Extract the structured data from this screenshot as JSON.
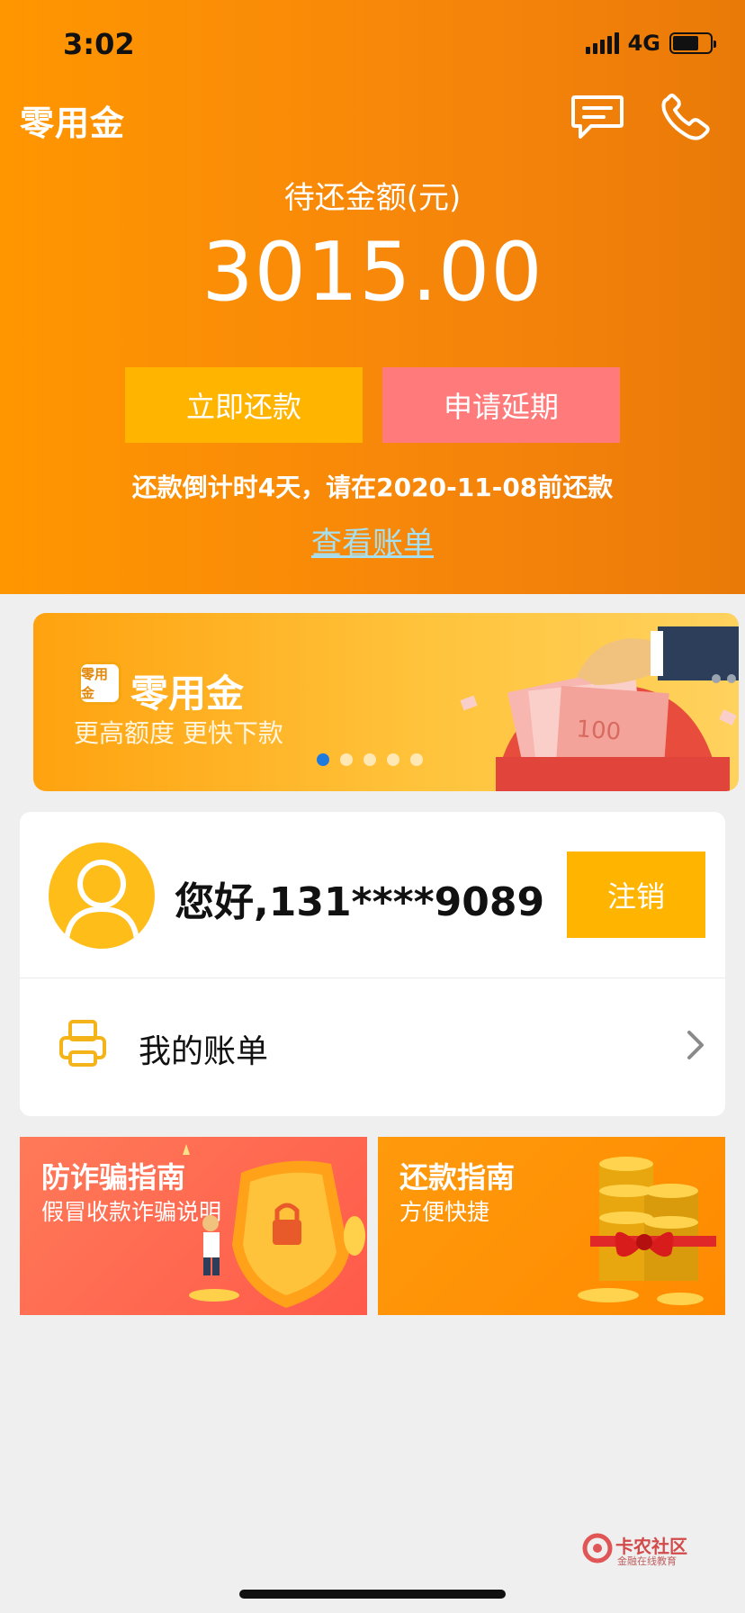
{
  "status_bar": {
    "time": "3:02",
    "network": "4G"
  },
  "header": {
    "app_name": "零用金",
    "amount_label": "待还金额(元)",
    "amount": "3015.00",
    "repay_button": "立即还款",
    "extend_button": "申请延期",
    "countdown": "还款倒计时4天，请在2020-11-08前还款",
    "view_bill_link": "查看账单"
  },
  "banner": {
    "logo_text": "零用金",
    "title": "零用金",
    "subtitle": "更高额度 更快下款",
    "slides": 5,
    "active_slide": 1
  },
  "user_card": {
    "greeting": "您好,131****9089",
    "logout_button": "注销",
    "bill_row_label": "我的账单"
  },
  "tiles": [
    {
      "title": "防诈骗指南",
      "subtitle": "假冒收款诈骗说明"
    },
    {
      "title": "还款指南",
      "subtitle": "方便快捷"
    }
  ],
  "watermark": {
    "name": "卡农社区",
    "tagline": "金融在线教育"
  },
  "colors": {
    "primary": "#ff9600",
    "button_yellow": "#ffb400",
    "button_pink": "#ff7a7a",
    "link": "#a6e0f0"
  }
}
